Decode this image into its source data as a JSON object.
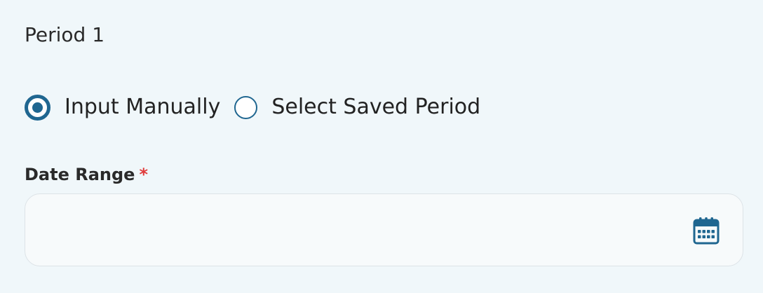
{
  "period": {
    "title": "Period 1"
  },
  "input_mode": {
    "options": [
      {
        "label": "Input Manually",
        "selected": true
      },
      {
        "label": "Select Saved Period",
        "selected": false
      }
    ]
  },
  "date_range": {
    "label": "Date Range",
    "required_marker": "*",
    "value": "",
    "placeholder": "",
    "icon": "calendar-icon"
  },
  "colors": {
    "accent": "#1f6690",
    "required": "#e03b3b",
    "background": "#f0f7fa"
  }
}
